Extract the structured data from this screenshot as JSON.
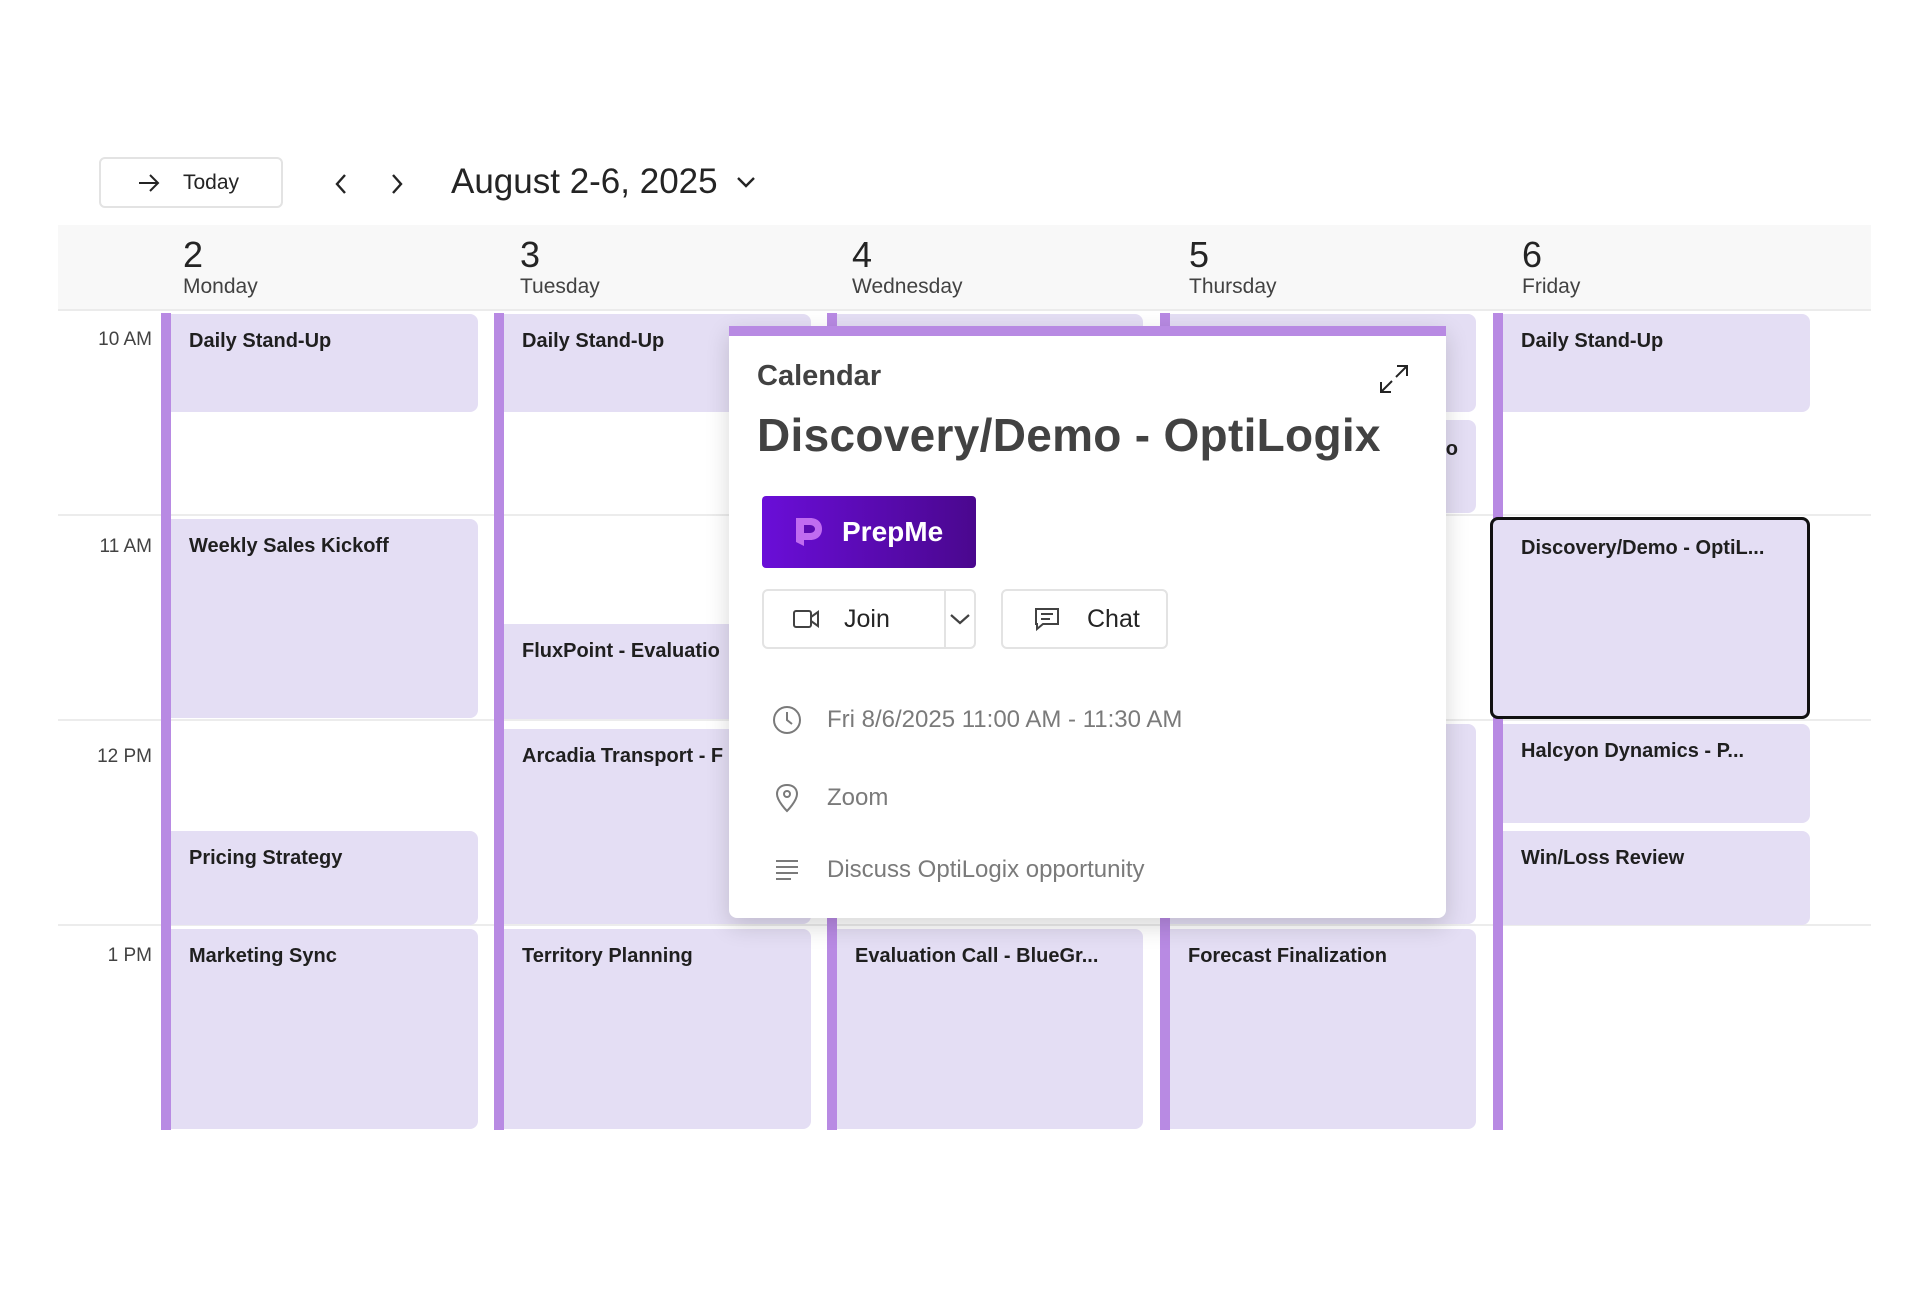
{
  "toolbar": {
    "today_label": "Today",
    "date_range": "August 2-6, 2025"
  },
  "days": [
    {
      "num": "2",
      "name": "Monday"
    },
    {
      "num": "3",
      "name": "Tuesday"
    },
    {
      "num": "4",
      "name": "Wednesday"
    },
    {
      "num": "5",
      "name": "Thursday"
    },
    {
      "num": "6",
      "name": "Friday"
    }
  ],
  "times": [
    "10 AM",
    "11 AM",
    "12 PM",
    "1 PM"
  ],
  "events": {
    "mon_standup": "Daily Stand-Up",
    "mon_kickoff": "Weekly Sales Kickoff",
    "mon_pricing": "Pricing Strategy",
    "mon_marketing": "Marketing Sync",
    "tue_standup": "Daily Stand-Up",
    "tue_fluxpoint": "FluxPoint - Evaluatio",
    "tue_arcadia": "Arcadia Transport - F",
    "tue_territory": "Territory Planning",
    "wed_evaluation": "Evaluation Call - BlueGr...",
    "thu_partial": "o",
    "thu_forecast": "Forecast Finalization",
    "fri_standup": "Daily Stand-Up",
    "fri_discovery": "Discovery/Demo - OptiL...",
    "fri_halcyon": "Halcyon Dynamics - P...",
    "fri_winloss": "Win/Loss Review"
  },
  "popover": {
    "label": "Calendar",
    "title": "Discovery/Demo - OptiLogix",
    "prepme_label": "PrepMe",
    "join_label": "Join",
    "chat_label": "Chat",
    "datetime": "Fri 8/6/2025 11:00 AM - 11:30 AM",
    "location": "Zoom",
    "description": "Discuss OptiLogix opportunity"
  },
  "colors": {
    "accent": "#b88ae3",
    "event_bg": "#e4def4",
    "prepme_start": "#6a0ed8",
    "prepme_end": "#4a078e"
  }
}
